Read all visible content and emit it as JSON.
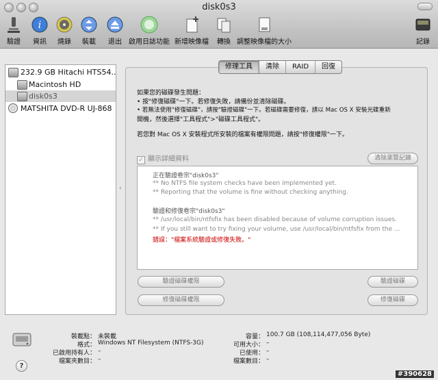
{
  "window": {
    "title": "disk0s3"
  },
  "toolbar": [
    {
      "label": "驗證",
      "icon": "microscope-icon"
    },
    {
      "label": "資訊",
      "icon": "info-icon"
    },
    {
      "label": "燒錄",
      "icon": "burn-disc-icon"
    },
    {
      "label": "裝載",
      "icon": "mount-icon"
    },
    {
      "label": "退出",
      "icon": "eject-icon"
    },
    {
      "label": "啟用日誌功能",
      "icon": "journaling-icon"
    },
    {
      "label": "新增映像檔",
      "icon": "new-image-icon"
    },
    {
      "label": "轉換",
      "icon": "convert-icon"
    },
    {
      "label": "調整映像檔的大小",
      "icon": "resize-image-icon"
    },
    {
      "label": "記錄",
      "icon": "log-icon"
    }
  ],
  "sidebar": {
    "items": [
      {
        "label": "232.9 GB Hitachi HTS54...",
        "kind": "disk"
      },
      {
        "label": "Macintosh HD",
        "kind": "volume"
      },
      {
        "label": "disk0s3",
        "kind": "volume"
      },
      {
        "label": "MATSHITA DVD-R UJ-868",
        "kind": "dvd"
      }
    ]
  },
  "tabs": [
    "修理工具",
    "清除",
    "RAID",
    "回復"
  ],
  "info": {
    "l1": "如果您的磁碟發生問題：",
    "l2": "• 按\"修復磁碟\"一下。若修復失敗，請備份並清除磁碟。",
    "l3": "• 若無法使用\"修復磁碟\"，請按\"驗證磁碟\"一下。若磁碟需要修復，請以 Mac OS X 安裝光碟重新",
    "l4": "  開機，然後選擇\"工具程式\">\"磁碟工具程式\"。",
    "l5": "若您對 Mac OS X 安裝程式所安裝的檔案有權限問題，請按\"修復權限\"一下。"
  },
  "details": {
    "checkbox_label": "顯示詳細資料",
    "clear_history": "清除瀏覽記錄"
  },
  "log": [
    {
      "text": "正在驗證卷宗\"disk0s3\"",
      "style": "head"
    },
    {
      "text": "** No NTFS file system checks have been implemented yet.",
      "style": "normal"
    },
    {
      "text": "** Reporting that the volume is fine without checking anything.",
      "style": "normal"
    },
    {
      "text": "驗證和修復卷宗\"disk0s3\"",
      "style": "head"
    },
    {
      "text": "** /usr/local/bin/ntfsfix has been disabled because of volume corruption issues.",
      "style": "normal"
    },
    {
      "text": "** If you still want to try fixing your volume, use /usr/local/bin/ntfsfix from the ...",
      "style": "normal"
    },
    {
      "text": "錯誤：\"檔案系統驗證或修復失敗。\"",
      "style": "err"
    }
  ],
  "buttons": {
    "verify_permissions": "驗證磁碟權限",
    "repair_permissions": "修復磁碟權限",
    "verify_disk": "驗證磁碟",
    "repair_disk": "修復磁碟"
  },
  "bottom": {
    "mount_point_key": "裝載點：",
    "mount_point_val": "未裝載",
    "format_key": "格式：",
    "format_val": "Windows NT Filesystem (NTFS-3G)",
    "owners_key": "已啟用持有人：",
    "owners_val": "–",
    "folders_key": "檔案夾數目：",
    "folders_val": "–",
    "capacity_key": "容量：",
    "capacity_val": "100.7 GB (108,114,477,056 Byte)",
    "available_key": "可用大小：",
    "available_val": "–",
    "used_key": "已使用：",
    "used_val": "–",
    "files_key": "檔案數目：",
    "files_val": "–"
  },
  "help": "?",
  "watermark": "#390628"
}
